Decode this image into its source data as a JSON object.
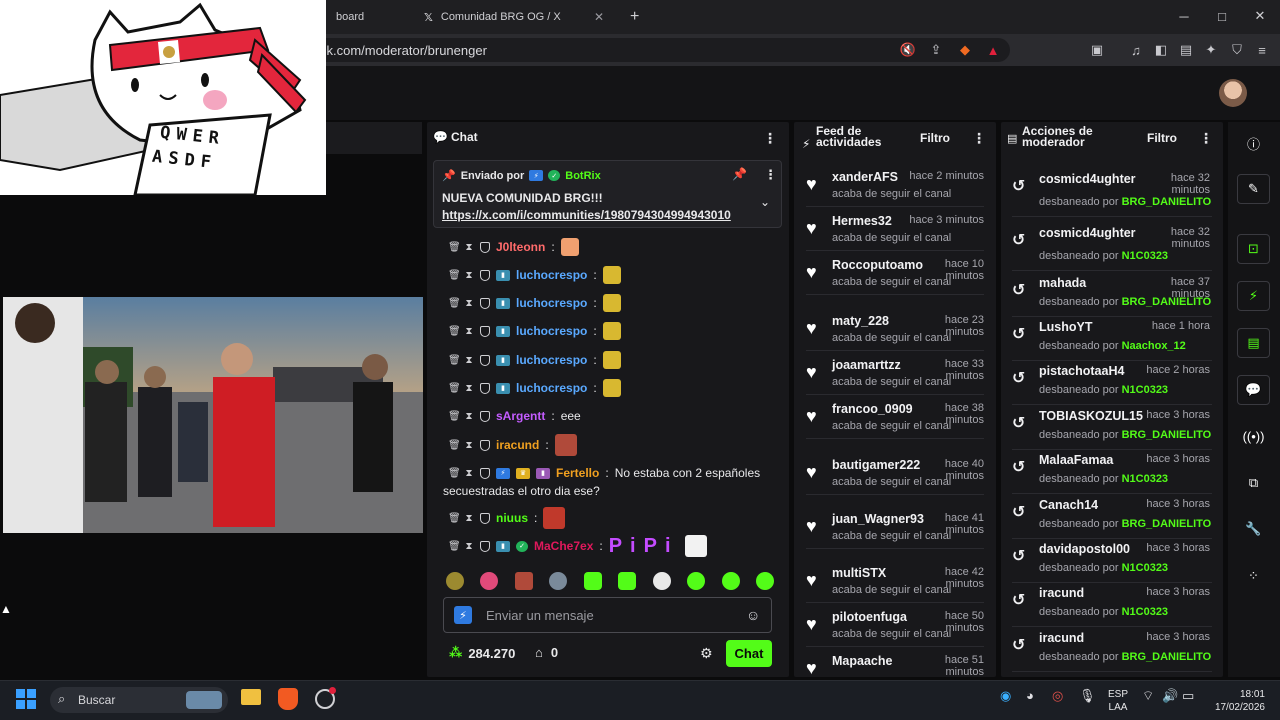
{
  "browser": {
    "tabs": [
      {
        "label": "board"
      },
      {
        "label": "Comunidad BRG OG / X"
      }
    ],
    "new_tab": "+",
    "url": "ck.com/moderator/brunenger",
    "window_controls": [
      "─",
      "□",
      "✕"
    ]
  },
  "chat": {
    "title": "Chat",
    "pinned": {
      "sent_by_label": "Enviado por",
      "sender": "BotRix",
      "title": "NUEVA COMUNIDAD BRG!!!",
      "link": "https://x.com/i/communities/1980794304994943010"
    },
    "messages": [
      {
        "user": "J0lteonn",
        "text": "",
        "color": "#ff6b6b",
        "emote": "#f0a070"
      },
      {
        "user": "luchocrespo",
        "text": "",
        "color": "#5aa9ff",
        "emote": "#d8b830"
      },
      {
        "user": "luchocrespo",
        "text": "",
        "color": "#5aa9ff",
        "emote": "#d8b830"
      },
      {
        "user": "luchocrespo",
        "text": "",
        "color": "#5aa9ff",
        "emote": "#d8b830"
      },
      {
        "user": "luchocrespo",
        "text": "",
        "color": "#5aa9ff",
        "emote": "#d8b830"
      },
      {
        "user": "luchocrespo",
        "text": "",
        "color": "#5aa9ff",
        "emote": "#d8b830"
      },
      {
        "user": "sArgentt",
        "text": "eee",
        "color": "#c45cff"
      },
      {
        "user": "iracund",
        "text": "",
        "color": "#f0a020",
        "emote": "#b04a3a"
      },
      {
        "user": "Fertello",
        "text": "No estaba con 2 españoles",
        "text2": "secuestradas el otro dia ese?",
        "color": "#f0a020"
      },
      {
        "user": "niuus",
        "text": "",
        "color": "#53fc18",
        "emote": "#c0392b"
      },
      {
        "user": "MaChe7ex",
        "text": "",
        "color": "#e0185c"
      }
    ],
    "input_placeholder": "Enviar un mensaje",
    "points": "284.270",
    "store_count": "0",
    "send_label": "Chat"
  },
  "feed": {
    "title_line1": "Feed de",
    "title_line2": "actividades",
    "filter_label": "Filtro",
    "subtitle": "acaba de seguir el canal",
    "items": [
      {
        "user": "xanderAFS",
        "time": "hace 2 minutos"
      },
      {
        "user": "Hermes32",
        "time": "hace 3 minutos"
      },
      {
        "user": "Roccoputoamo",
        "time": "hace 10 minutos"
      },
      {
        "user": "maty_228",
        "time": "hace 23 minutos"
      },
      {
        "user": "joaamarttzz",
        "time": "hace 33 minutos"
      },
      {
        "user": "francoo_0909",
        "time": "hace 38 minutos"
      },
      {
        "user": "bautigamer222",
        "time": "hace 40 minutos"
      },
      {
        "user": "juan_Wagner93",
        "time": "hace 41 minutos"
      },
      {
        "user": "multiSTX",
        "time": "hace 42 minutos"
      },
      {
        "user": "pilotoenfuga",
        "time": "hace 50 minutos"
      },
      {
        "user": "Mapaache",
        "time": "hace 51 minutos"
      }
    ]
  },
  "mod": {
    "title_line1": "Acciones de",
    "title_line2": "moderador",
    "filter_label": "Filtro",
    "unbanned_label": "desbaneado por",
    "items": [
      {
        "user": "cosmicd4ughter",
        "time": "hace 32 minutos",
        "by": "BRG_DANIELITO"
      },
      {
        "user": "cosmicd4ughter",
        "time": "hace 32 minutos",
        "by": "N1C0323"
      },
      {
        "user": "mahada",
        "time": "hace 37 minutos",
        "by": "BRG_DANIELITO"
      },
      {
        "user": "LushoYT",
        "time": "hace 1 hora",
        "by": "Naachox_12"
      },
      {
        "user": "pistachotaaH4",
        "time": "hace 2 horas",
        "by": "N1C0323"
      },
      {
        "user": "TOBIASKOZUL15",
        "time": "hace 3 horas",
        "by": "BRG_DANIELITO"
      },
      {
        "user": "MalaaFamaa",
        "time": "hace 3 horas",
        "by": "N1C0323"
      },
      {
        "user": "Canach14",
        "time": "hace 3 horas",
        "by": "BRG_DANIELITO"
      },
      {
        "user": "davidapostol00",
        "time": "hace 3 horas",
        "by": "N1C0323"
      },
      {
        "user": "iracund",
        "time": "hace 3 horas",
        "by": "N1C0323"
      },
      {
        "user": "iracund",
        "time": "hace 3 horas",
        "by": "BRG_DANIELITO"
      }
    ]
  },
  "taskbar": {
    "search_placeholder": "Buscar",
    "lang_top": "ESP",
    "lang_bottom": "LAA",
    "time": "18:01",
    "date": "17/02/2026"
  },
  "sticker_keys": [
    "Q",
    "W",
    "E",
    "R",
    "A",
    "S",
    "D",
    "F"
  ],
  "colors": {
    "accent": "#53fc18",
    "panel": "#18181b",
    "background": "#0b0b0c"
  }
}
